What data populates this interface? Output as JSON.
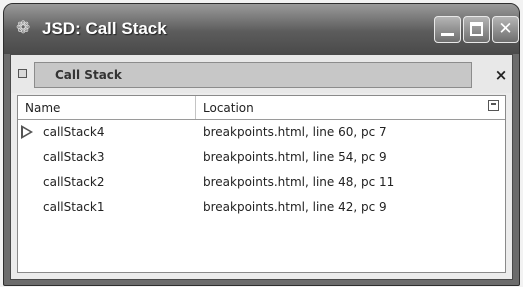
{
  "window": {
    "title": "JSD: Call Stack",
    "app_icon": "jsd-app-icon"
  },
  "panel": {
    "title": "Call Stack",
    "close_label": "×"
  },
  "columns": {
    "name": "Name",
    "location": "Location"
  },
  "rows": [
    {
      "name": "callStack4",
      "location": "breakpoints.html, line 60, pc 7",
      "current": true
    },
    {
      "name": "callStack3",
      "location": "breakpoints.html, line 54, pc 9",
      "current": false
    },
    {
      "name": "callStack2",
      "location": "breakpoints.html, line 48, pc 11",
      "current": false
    },
    {
      "name": "callStack1",
      "location": "breakpoints.html, line 42, pc 9",
      "current": false
    }
  ]
}
